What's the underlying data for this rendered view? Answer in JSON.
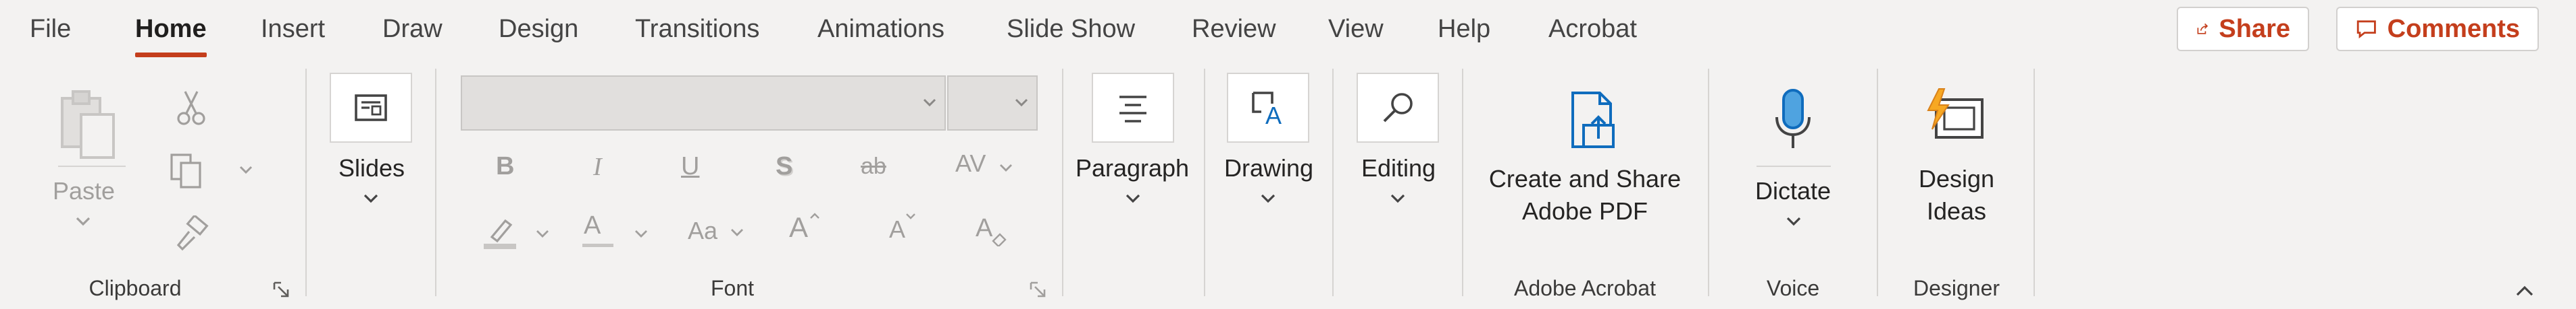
{
  "tabs": [
    {
      "label": "File"
    },
    {
      "label": "Home"
    },
    {
      "label": "Insert"
    },
    {
      "label": "Draw"
    },
    {
      "label": "Design"
    },
    {
      "label": "Transitions"
    },
    {
      "label": "Animations"
    },
    {
      "label": "Slide Show"
    },
    {
      "label": "Review"
    },
    {
      "label": "View"
    },
    {
      "label": "Help"
    },
    {
      "label": "Acrobat"
    }
  ],
  "active_tab": "Home",
  "top_buttons": {
    "share": "Share",
    "comments": "Comments"
  },
  "groups": {
    "clipboard": {
      "label": "Clipboard",
      "paste": "Paste"
    },
    "slides": {
      "button": "Slides"
    },
    "font": {
      "label": "Font",
      "font_name": "",
      "font_size": "",
      "bold": "B",
      "italic": "I",
      "underline": "U",
      "shadow": "S",
      "strike": "ab",
      "spacing": "AV",
      "font_color": "A",
      "change_case": "Aa",
      "grow": "A",
      "shrink": "A",
      "clear": "A"
    },
    "paragraph": {
      "button": "Paragraph"
    },
    "drawing": {
      "button": "Drawing"
    },
    "editing": {
      "button": "Editing"
    },
    "adobe": {
      "label": "Adobe Acrobat",
      "line1": "Create and Share",
      "line2": "Adobe PDF"
    },
    "voice": {
      "label": "Voice",
      "button": "Dictate"
    },
    "designer": {
      "label": "Designer",
      "line1": "Design",
      "line2": "Ideas"
    }
  },
  "colors": {
    "accent": "#c43e1c",
    "background": "#f3f2f1",
    "disabled": "#a19f9d"
  }
}
